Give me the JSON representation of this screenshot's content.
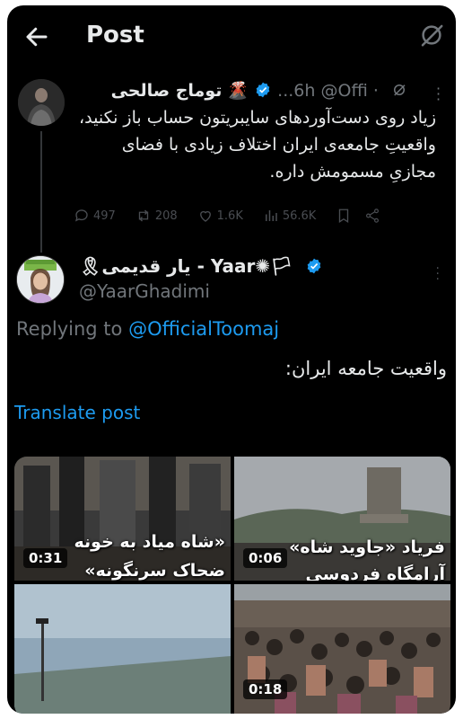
{
  "topbar": {
    "title": "Post",
    "back_icon": "arrow-left-icon",
    "grok_icon": "grok-icon"
  },
  "original": {
    "name": "توماج صالحی",
    "emoji": "🌋",
    "handle": "@Offi...",
    "time": "· 6h",
    "text": "زیاد روی دست‌آوردهای سایبریتون حساب باز نکنید، واقعیتِ جامعه‌ی ایران اختلاف زیادی با فضای مجازیِ مسمومش داره.",
    "replies": "497",
    "reposts": "208",
    "likes": "1.6K",
    "views": "56.6K"
  },
  "reply": {
    "name": "🎗یار قدیمی - Yaar✺🏳",
    "handle": "@YaarGhadimi",
    "replying_prefix": "Replying to ",
    "replying_handle": "@OfficialToomaj",
    "text": "واقعیت جامعه ایران:",
    "translate": "Translate post"
  },
  "media": [
    {
      "duration": "0:31",
      "caption1": "«شاه میاد به خونه",
      "caption2": "ضحاک سرنگونه»"
    },
    {
      "duration": "0:06",
      "caption1": "فریاد «جاوید شاه»",
      "caption2": "آرامگاه فردوسی"
    },
    {
      "duration": ""
    },
    {
      "duration": "0:18"
    }
  ],
  "colors": {
    "accent": "#1d9bf0",
    "background": "#000000",
    "muted": "#71767b"
  }
}
